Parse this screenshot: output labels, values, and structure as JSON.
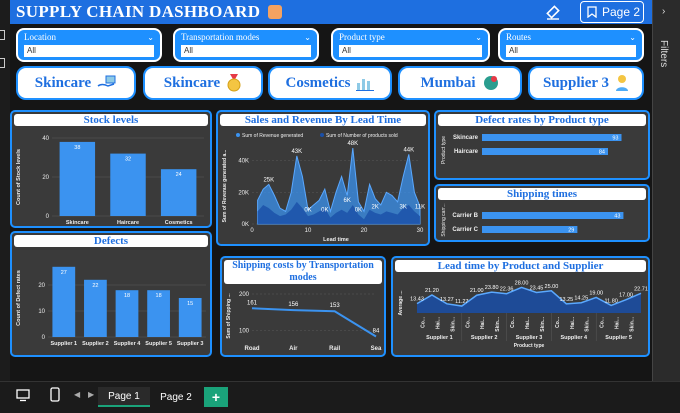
{
  "header": {
    "title": "SUPPLY CHAIN DASHBOARD",
    "bookmark_label": "Page 2"
  },
  "filters_pane_label": "Filters",
  "slicers": [
    {
      "label": "Location",
      "value": "All"
    },
    {
      "label": "Transportation modes",
      "value": "All"
    },
    {
      "label": "Product type",
      "value": "All"
    },
    {
      "label": "Routes",
      "value": "All"
    }
  ],
  "cards": [
    {
      "label": "Skincare",
      "icon": "hand-money-icon"
    },
    {
      "label": "Skincare",
      "icon": "medal-icon"
    },
    {
      "label": "Cosmetics",
      "icon": "bar-chart-icon"
    },
    {
      "label": "Mumbai",
      "icon": "globe-pin-icon"
    },
    {
      "label": "Supplier 3",
      "icon": "person-icon"
    }
  ],
  "tabs": {
    "page1": "Page 1",
    "page2": "Page 2",
    "add": "+"
  },
  "colors": {
    "accent": "#1e90ff",
    "header": "#1e6fe0",
    "panel_bg": "#3a3a3a",
    "active_tab": "#1aa37a"
  },
  "chart_data": [
    {
      "id": "stock",
      "type": "bar",
      "title": "Stock levels",
      "ylabel": "Count of Stock levels",
      "categories": [
        "Skincare",
        "Haircare",
        "Cosmetics"
      ],
      "values": [
        38,
        32,
        24
      ],
      "yticks": [
        "0",
        "20",
        "40"
      ],
      "ylim": [
        0,
        40
      ]
    },
    {
      "id": "defects",
      "type": "bar",
      "title": "Defects",
      "ylabel": "Count of Defect rates",
      "categories": [
        "Supplier 1",
        "Supplier 2",
        "Supplier 4",
        "Supplier 5",
        "Supplier 3"
      ],
      "values": [
        27,
        22,
        18,
        18,
        15
      ],
      "yticks": [
        "0",
        "10",
        "20"
      ],
      "ylim": [
        0,
        30
      ]
    },
    {
      "id": "sales",
      "type": "area",
      "title": "Sales and Revenue By Lead Time",
      "xlabel": "Lead time",
      "ylabel": "Sum of Revenue generated a...",
      "legend": [
        "Sum of Revenue generated",
        "Sum of Number of products sold"
      ],
      "yticks": [
        "0K",
        "20K",
        "40K"
      ],
      "xticks": [
        "0",
        "10",
        "20",
        "30"
      ],
      "ylim": [
        0,
        48
      ],
      "xlim": [
        0,
        30
      ],
      "revenue_x": [
        1,
        2,
        3,
        4,
        5,
        6,
        7,
        8,
        9,
        10,
        11,
        12,
        13,
        14,
        15,
        16,
        17,
        18,
        19,
        20,
        21,
        22,
        23,
        24,
        25,
        26,
        27,
        28,
        29,
        30
      ],
      "revenue_y": [
        15,
        22,
        25,
        18,
        10,
        8,
        20,
        43,
        30,
        9,
        12,
        15,
        22,
        8,
        20,
        30,
        18,
        48,
        14,
        8,
        25,
        16,
        12,
        20,
        18,
        14,
        30,
        44,
        20,
        11
      ],
      "products_y": [
        8,
        12,
        10,
        7,
        5,
        6,
        9,
        14,
        10,
        5,
        6,
        8,
        10,
        4,
        7,
        9,
        7,
        12,
        6,
        3,
        9,
        7,
        6,
        8,
        7,
        6,
        10,
        12,
        8,
        5
      ],
      "labels": [
        "25K",
        "43K",
        "0K",
        "0K",
        "6K",
        "48K",
        "0K",
        "2K",
        "3K",
        "44K",
        "11K"
      ]
    },
    {
      "id": "defect_rate",
      "type": "bar",
      "orientation": "horizontal",
      "title": "Defect rates by Product type",
      "ylabel": "Product type",
      "categories": [
        "Skincare",
        "Haircare"
      ],
      "values": [
        93,
        84
      ],
      "xlim": [
        0,
        100
      ]
    },
    {
      "id": "shipping_times",
      "type": "bar",
      "orientation": "horizontal",
      "title": "Shipping times",
      "ylabel": "Shipping carr...",
      "categories": [
        "Carrier B",
        "Carrier C"
      ],
      "values": [
        43,
        29
      ],
      "xlim": [
        0,
        45
      ]
    },
    {
      "id": "shipping_costs",
      "type": "line",
      "title": "Shipping costs by Transportation modes",
      "ylabel": "Sum of Shipping ...",
      "categories": [
        "Road",
        "Air",
        "Rail",
        "Sea"
      ],
      "values": [
        161,
        156,
        153,
        84
      ],
      "yticks": [
        "100",
        "200"
      ],
      "ylim": [
        80,
        200
      ]
    },
    {
      "id": "lead_time",
      "type": "line",
      "title": "Lead time by Product and Supplier",
      "xlabel": "Product type",
      "ylabel": "Average ...",
      "groups": [
        "Supplier 1",
        "Supplier 2",
        "Supplier 3",
        "Supplier 4",
        "Supplier 5"
      ],
      "subcategories": [
        "Co...",
        "Hai...",
        "Skin..."
      ],
      "values": [
        13.43,
        21.2,
        13.27,
        11.27,
        21.0,
        23.8,
        22.36,
        28.0,
        23.45,
        25.0,
        13.25,
        14.25,
        19.0,
        11.8,
        17.0,
        22.71
      ],
      "labels": [
        "13.43",
        "21.20",
        "13.27",
        "11.27",
        "21.00",
        "23.80",
        "22.36",
        "28.00",
        "23.45",
        "25.00",
        "13.25",
        "14.25",
        "19.00",
        "11.80",
        "17.00",
        "22.71"
      ],
      "ylim": [
        5,
        32
      ]
    }
  ]
}
